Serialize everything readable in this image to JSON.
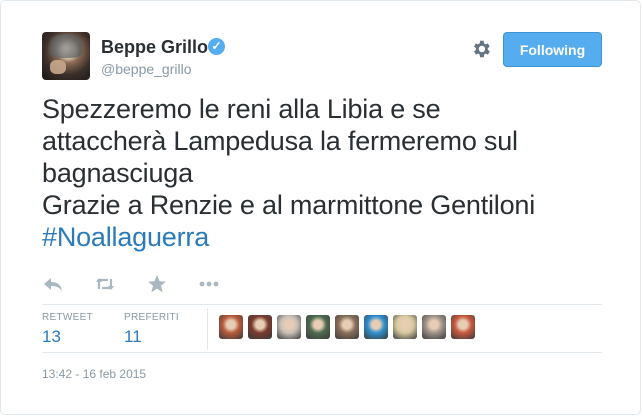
{
  "user": {
    "name": "Beppe Grillo",
    "handle": "@beppe_grillo",
    "verified_mark": "✓"
  },
  "follow_button": {
    "label": "Following"
  },
  "tweet": {
    "lines": [
      "Spezzeremo le reni alla Libia e se",
      "attaccherà Lampedusa la fermeremo sul",
      "bagnasciuga",
      "Grazie a Renzie e al marmittone Gentiloni"
    ],
    "hashtag": "#Noallaguerra"
  },
  "actions": {
    "reply_icon": "reply-icon",
    "retweet_icon": "retweet-icon",
    "favorite_icon": "star-icon",
    "more_icon": "more-icon"
  },
  "stats": {
    "retweets": {
      "label": "RETWEET",
      "value": "13"
    },
    "favorites": {
      "label": "PREFERITI",
      "value": "11"
    }
  },
  "favoriters": {
    "count_shown": 9,
    "colors": [
      "#b85a3c",
      "#7a3b2e",
      "#c9c0b8",
      "#4d6b4f",
      "#8a6f5a",
      "#2f8fd0",
      "#d8c9a0",
      "#a0938a",
      "#c8583d"
    ]
  },
  "timestamp": "13:42 - 16 feb 2015",
  "colors": {
    "accent": "#55acee",
    "link": "#2b7bb9",
    "muted": "#8899a6",
    "text": "#292f33"
  }
}
